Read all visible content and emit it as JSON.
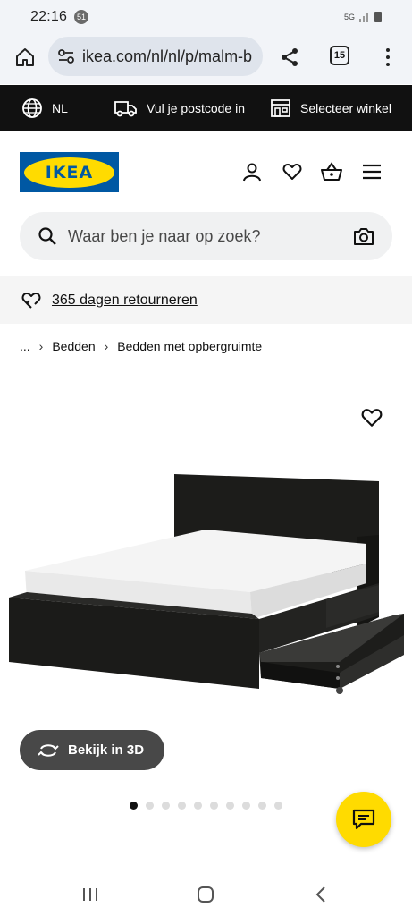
{
  "status": {
    "time": "22:16",
    "notif_count": "51",
    "network": "5G"
  },
  "browser": {
    "url": "ikea.com/nl/nl/p/malm-b",
    "tab_count": "15"
  },
  "utility": {
    "country": "NL",
    "postcode": "Vul je postcode in",
    "store": "Selecteer winkel"
  },
  "header": {
    "logo_text": "IKEA"
  },
  "search": {
    "placeholder": "Waar ben je naar op zoek?"
  },
  "returns": {
    "label": "365 dagen retourneren"
  },
  "breadcrumb": {
    "ellipsis": "...",
    "items": [
      "Bedden",
      "Bedden met opbergruimte"
    ]
  },
  "product": {
    "view3d_label": "Bekijk in 3D",
    "carousel": {
      "total": 10,
      "active": 0
    }
  },
  "colors": {
    "ikea_blue": "#0058a3",
    "ikea_yellow": "#ffdb00",
    "util_bar": "#111111",
    "button_dark": "#484848"
  },
  "icons": [
    "home-icon",
    "site-settings-icon",
    "share-icon",
    "tabs-icon",
    "more-icon",
    "globe-icon",
    "truck-icon",
    "store-icon",
    "user-icon",
    "heart-icon",
    "basket-icon",
    "hamburger-icon",
    "search-icon",
    "camera-icon",
    "return-heart-icon",
    "favourite-icon",
    "rotate-3d-icon",
    "chat-icon",
    "recents-icon",
    "home-nav-icon",
    "back-nav-icon"
  ]
}
